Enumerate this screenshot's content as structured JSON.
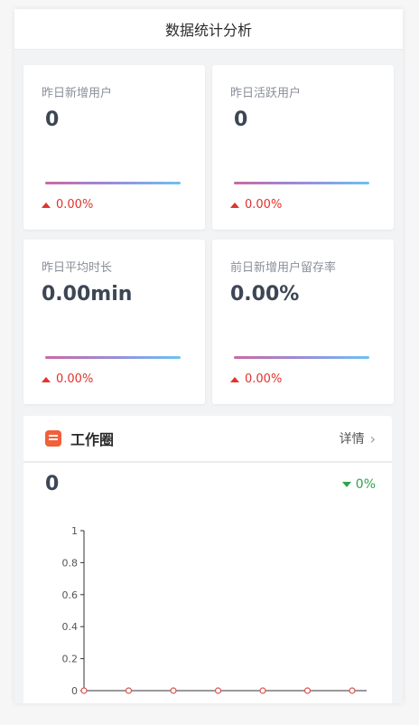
{
  "header": {
    "title": "数据统计分析"
  },
  "cards": [
    {
      "title": "昨日新增用户",
      "value": "0",
      "change": "0.00%"
    },
    {
      "title": "昨日活跃用户",
      "value": "0",
      "change": "0.00%"
    },
    {
      "title": "昨日平均时长",
      "value": "0.00min",
      "change": "0.00%"
    },
    {
      "title": "前日新增用户留存率",
      "value": "0.00%",
      "change": "0.00%"
    }
  ],
  "work": {
    "title": "工作圈",
    "detail_label": "详情",
    "value": "0",
    "change": "0%"
  },
  "colors": {
    "up": "#e0332e",
    "down": "#2ea34a",
    "line_start": "#c86aa4",
    "line_end": "#6cc3ee"
  },
  "chart_data": {
    "type": "line",
    "x": [
      "",
      "",
      "",
      "",
      "",
      "",
      ""
    ],
    "values": [
      0,
      0,
      0,
      0,
      0,
      0,
      0
    ],
    "ylim": [
      0,
      1
    ],
    "y_ticks": [
      "0",
      "0.2",
      "0.4",
      "0.6",
      "0.8",
      "1"
    ],
    "grid": false
  }
}
